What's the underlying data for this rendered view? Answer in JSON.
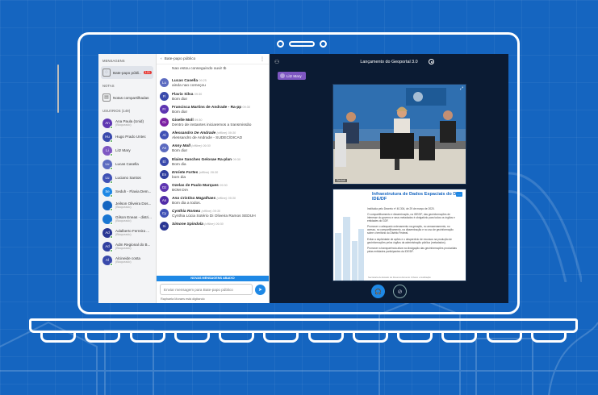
{
  "sidebar": {
    "messages_heading": "MENSAGENS",
    "public_chat": {
      "label": "Bate-papo públi...",
      "badge": "121"
    },
    "notes_heading": "NOTAS",
    "shared_notes": "Notas compartilhadas",
    "users_heading": "USUÁRIOS (149)",
    "users": [
      {
        "initials": "An",
        "name": "Ana Paula (Unid)",
        "sub": "(Bloqueado)",
        "color": "#5e35b1"
      },
      {
        "initials": "Hu",
        "name": "Hugo Prado Untec",
        "sub": "",
        "color": "#3949ab"
      },
      {
        "initials": "Li",
        "name": "Litz Mary",
        "sub": "",
        "color": "#7e57c2"
      },
      {
        "initials": "Lu",
        "name": "Lucas Casella",
        "sub": "",
        "color": "#5c6bc0"
      },
      {
        "initials": "Lu",
        "name": "Luciano Santos",
        "sub": "",
        "color": "#3f51b5"
      },
      {
        "initials": "Se",
        "name": "Seduh - Flavia Dem...",
        "sub": "",
        "color": "#1e88e5"
      },
      {
        "initials": "",
        "name": "Jeilson Oliveira Dos...",
        "sub": "(Bloqueado)",
        "color": "#1565c0"
      },
      {
        "initials": "",
        "name": "Gilson Eneas - distri...",
        "sub": "(Bloqueado)",
        "color": "#1976d2"
      },
      {
        "initials": "Ad",
        "name": "Adalberto Ferreira ...",
        "sub": "(Bloqueado)",
        "color": "#283593"
      },
      {
        "initials": "Ad",
        "name": "Adm Regional do B...",
        "sub": "(Bloqueado)",
        "color": "#303f9f"
      },
      {
        "initials": "Al",
        "name": "Alcineide costa",
        "sub": "(Bloqueado)",
        "color": "#3949ab"
      }
    ]
  },
  "chat": {
    "back_label": "Bate-papo público",
    "messages": [
      {
        "initials": "",
        "name": "",
        "time": "",
        "offline": "",
        "italic": false,
        "text": "Nao estou conseguindo ouvir tb",
        "color": "#5e35b1"
      },
      {
        "initials": "Lu",
        "name": "Lucas Casella",
        "time": "09:25",
        "offline": "",
        "italic": false,
        "text": "ainda nao começou",
        "color": "#5c6bc0"
      },
      {
        "initials": "Fl",
        "name": "Flavio Silva",
        "time": "09:30",
        "offline": "",
        "italic": false,
        "text": "Bom dia!",
        "color": "#3949ab"
      },
      {
        "initials": "Fr",
        "name": "Francisca Martins de Andrade - Ra-pp",
        "time": "09:30",
        "offline": "",
        "italic": false,
        "text": "Bom dia!",
        "color": "#5e35b1"
      },
      {
        "initials": "Gi",
        "name": "Giselle Moll",
        "time": "09:30",
        "offline": "",
        "italic": false,
        "text": "Dentro de instantes iniciaremos a transmissão",
        "color": "#7b1fa2"
      },
      {
        "initials": "Al",
        "name": "Alessandro De Andrade",
        "time": "09:30",
        "offline": "(offline)",
        "italic": true,
        "text": "Alessandro de Andrade - SUDEC/DICAD",
        "color": "#3f51b5"
      },
      {
        "initials": "An",
        "name": "Anny Moll",
        "time": "09:30",
        "offline": "(offline)",
        "italic": true,
        "text": "Bom dia!",
        "color": "#5c6bc0"
      },
      {
        "initials": "El",
        "name": "Elaine Sanches Gelosae Ra-plan",
        "time": "09:30",
        "offline": "",
        "italic": false,
        "text": "Bom dia",
        "color": "#3949ab"
      },
      {
        "initials": "En",
        "name": "Enriete Fortes",
        "time": "09:30",
        "offline": "(offline)",
        "italic": true,
        "text": "bom dia",
        "color": "#303f9f"
      },
      {
        "initials": "Oz",
        "name": "Ozelas de Paulo Marques",
        "time": "09:30",
        "offline": "",
        "italic": false,
        "text": "BOM DIA",
        "color": "#5e35b1"
      },
      {
        "initials": "An",
        "name": "Ana Cristina Magalhaes",
        "time": "09:30",
        "offline": "(offline)",
        "italic": true,
        "text": "Bom dia a todos.",
        "color": "#512da8"
      },
      {
        "initials": "Cy",
        "name": "Cynthia Romeu",
        "time": "09:30",
        "offline": "(offline)",
        "italic": true,
        "text": "Cynthia Lúcia Sotério Di Oliveira Ramos SEDUH",
        "color": "#3f51b5"
      },
      {
        "initials": "Si",
        "name": "Simone Spindola",
        "time": "09:30",
        "offline": "(offline)",
        "italic": true,
        "text": "",
        "color": "#283593"
      }
    ],
    "new_messages_label": "NOVAS MENSAGENS ABAIXO",
    "input_placeholder": "Enviar mensagem para Bate-papo público",
    "typing": "Raphaela Moraes está digitando"
  },
  "main": {
    "meeting_title": "Lançamento do Geoportal 3.0",
    "presenter": "Litz Mary",
    "webcam_label": "Seduh",
    "slide": {
      "title": "Infraestrutura de Dados Espaciais do DF - IDE/DF",
      "paragraphs": [
        "Instituída pelo Decreto nº 40.304, de 29 de março de 2020.",
        "O compartilhamento e disseminação, na IDE/DF, das geoinformações de interesse do governo e seus metadados é obrigatório para todos os órgãos e entidades do GDF.",
        "Promover o adequado ordenamento na geração, no armazenamento, no acesso, no compartilhamento, na disseminação e no uso de geoinformação sobre o território do Distrito Federal.",
        "Evitar a duplicidade de ações e o desperdício de recursos na produção de geoinformações pelos órgãos da administração pública (metadados).",
        "Promover a transparência ativa na divulgação das geoinformações produzidas pelas entidades participantes da IDE/DF."
      ],
      "footer": "Secretaria de Estado de Desenvolvimento Urbano e Habitação"
    }
  },
  "colors": {
    "background": "#1565c0",
    "main_dark": "#0b1b33",
    "accent": "#1e88e5",
    "badge": "#e53935"
  }
}
